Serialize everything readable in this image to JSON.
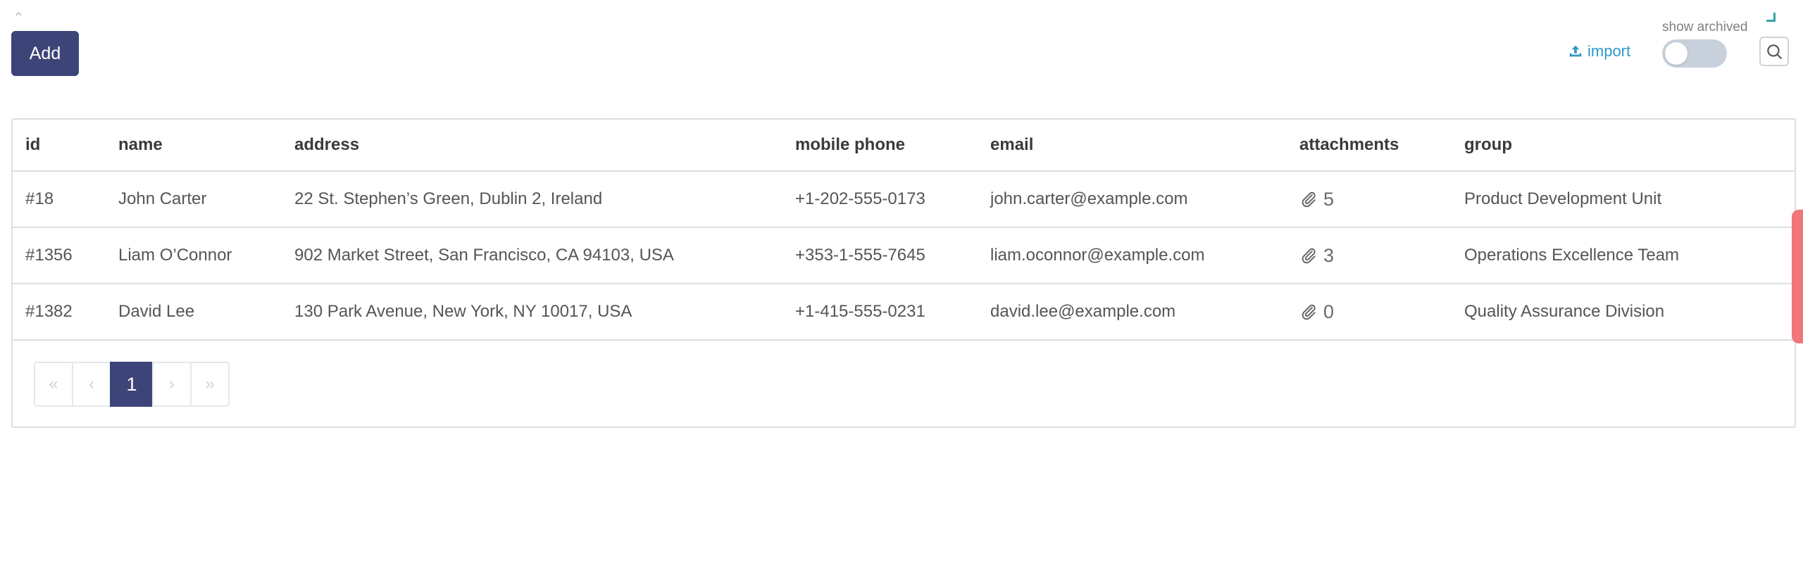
{
  "toolbar": {
    "add_label": "Add",
    "import_label": "import",
    "show_archived_label": "show archived",
    "show_archived_on": false
  },
  "table": {
    "columns": [
      "id",
      "name",
      "address",
      "mobile phone",
      "email",
      "attachments",
      "group"
    ],
    "rows": [
      {
        "id": "#18",
        "name": "John Carter",
        "address": "22 St. Stephen’s Green, Dublin 2, Ireland",
        "phone": "+1-202-555-0173",
        "email": "john.carter@example.com",
        "attachments": "5",
        "group": "Product Development Unit"
      },
      {
        "id": "#1356",
        "name": "Liam O’Connor",
        "address": "902 Market Street, San Francisco, CA 94103, USA",
        "phone": "+353-1-555-7645",
        "email": "liam.oconnor@example.com",
        "attachments": "3",
        "group": "Operations Excellence Team"
      },
      {
        "id": "#1382",
        "name": "David Lee",
        "address": "130 Park Avenue, New York, NY 10017, USA",
        "phone": "+1-415-555-0231",
        "email": "david.lee@example.com",
        "attachments": "0",
        "group": "Quality Assurance Division"
      }
    ]
  },
  "pagination": {
    "first": "«",
    "prev": "‹",
    "current": "1",
    "next": "›",
    "last": "»"
  },
  "icons": {
    "import": "upload-icon",
    "search": "search-icon",
    "attachment": "paperclip-icon"
  },
  "colors": {
    "primary": "#3d4478",
    "link": "#2f97c9",
    "accent_tab": "#f0767a"
  }
}
